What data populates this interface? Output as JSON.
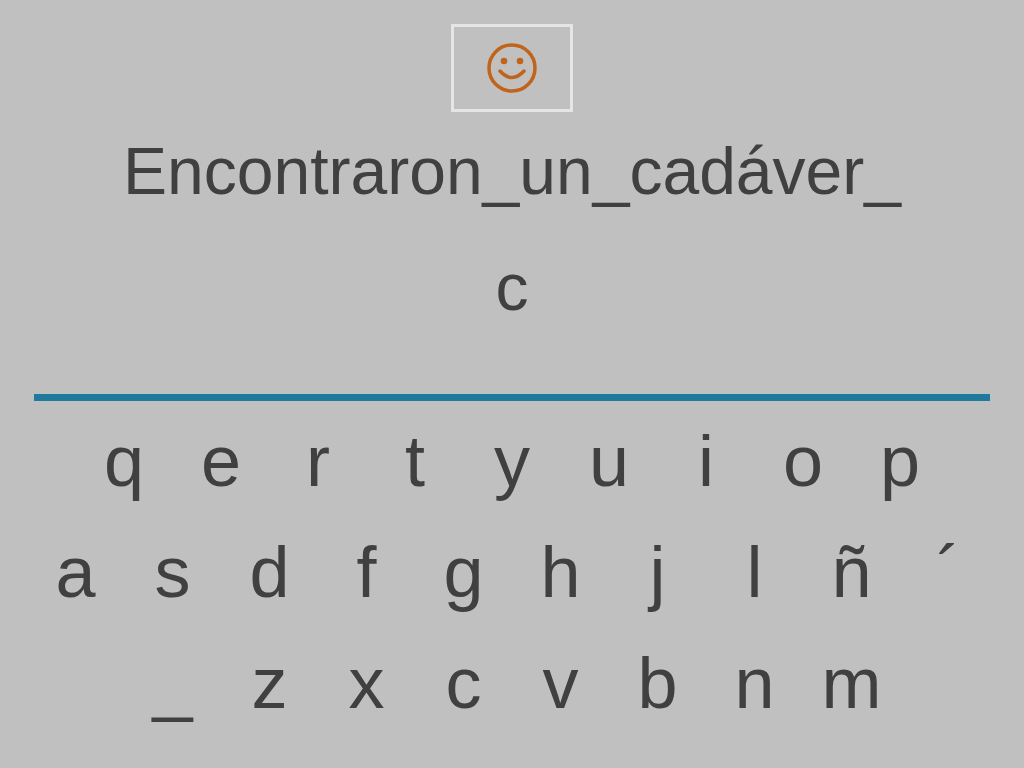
{
  "sentence": "Encontraron_un_cadáver_",
  "answer": "c",
  "keyboard": {
    "rows": [
      [
        "q",
        "e",
        "r",
        "t",
        "y",
        "u",
        "i",
        "o",
        "p"
      ],
      [
        "a",
        "s",
        "d",
        "f",
        "g",
        "h",
        "j",
        "l",
        "ñ",
        "´"
      ],
      [
        "_",
        "z",
        "x",
        "c",
        "v",
        "b",
        "n",
        "m"
      ]
    ]
  }
}
